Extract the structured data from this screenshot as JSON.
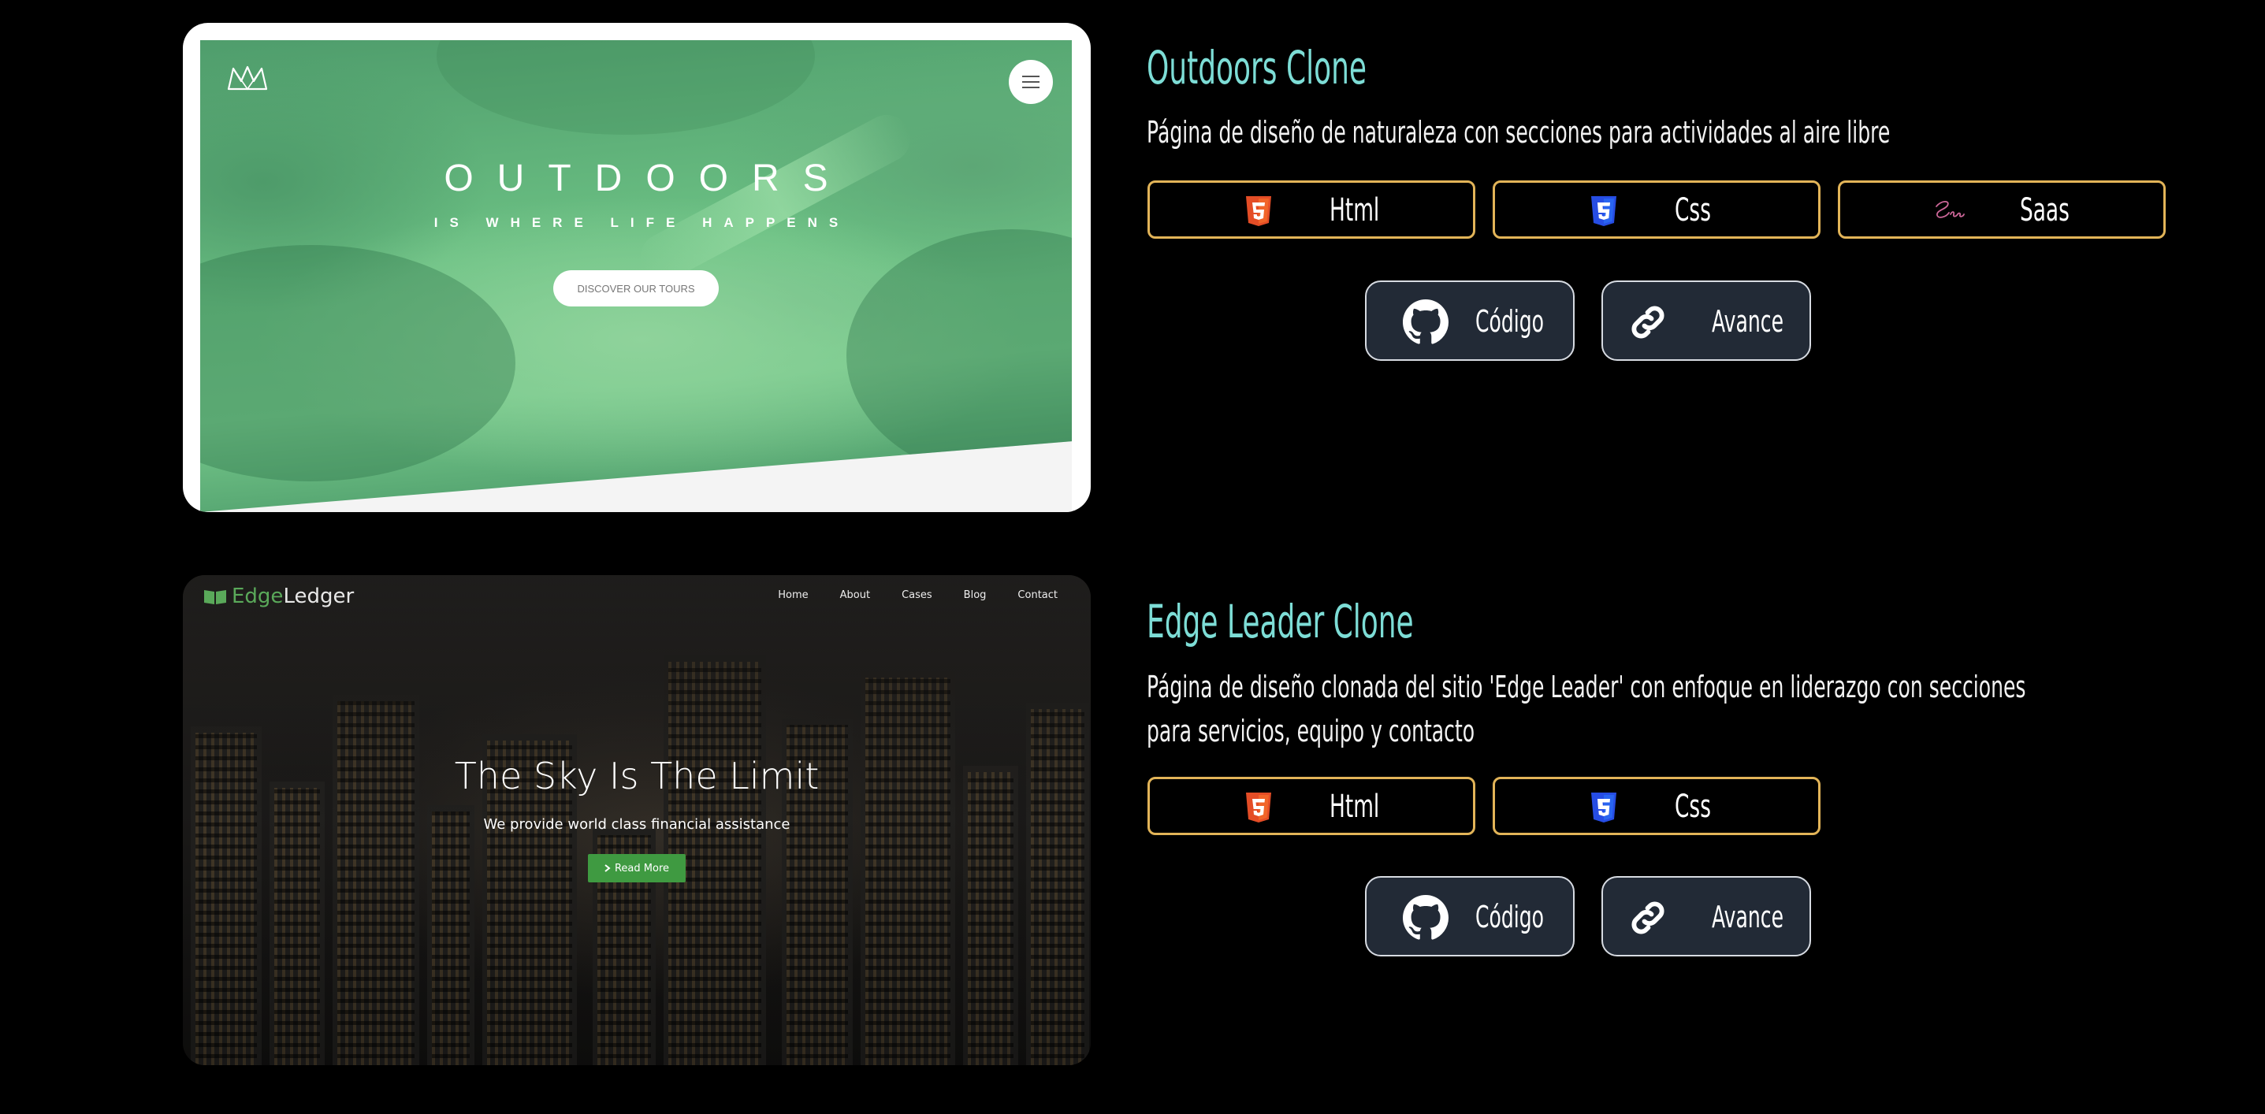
{
  "projects": [
    {
      "title": "Outdoors Clone",
      "description": "Página de diseño de naturaleza con secciones para actividades al aire libre",
      "preview": {
        "heading": "OUTDOORS",
        "subheading": "IS WHERE LIFE HAPPENS",
        "button": "DISCOVER OUR TOURS"
      },
      "technologies": [
        "Html",
        "Css",
        "Saas"
      ],
      "links": {
        "code": "Código",
        "preview": "Avance"
      }
    },
    {
      "title": "Edge Leader Clone",
      "description": "Página de diseño clonada del sitio 'Edge Leader' con enfoque en liderazgo con secciones para servicios, equipo y contacto",
      "preview": {
        "logo_part1": "Edge",
        "logo_part2": "Ledger",
        "nav": [
          "Home",
          "About",
          "Cases",
          "Blog",
          "Contact"
        ],
        "heading": "The Sky Is The Limit",
        "subheading": "We provide world class financial assistance",
        "button": "Read More"
      },
      "technologies": [
        "Html",
        "Css"
      ],
      "links": {
        "code": "Código",
        "preview": "Avance"
      }
    }
  ],
  "colors": {
    "title": "#7dddd6",
    "tech_border": "#e2b458",
    "link_button_bg": "#222a36",
    "html_icon": "#e44d26",
    "css_icon": "#264de4",
    "sass_icon": "#cd6799",
    "edge_green": "#3f9a41"
  },
  "icons": [
    "html5-icon",
    "css3-icon",
    "sass-icon",
    "github-icon",
    "link-icon",
    "crown-logo-icon",
    "hamburger-menu-icon",
    "book-logo-icon",
    "chevron-right-icon"
  ]
}
